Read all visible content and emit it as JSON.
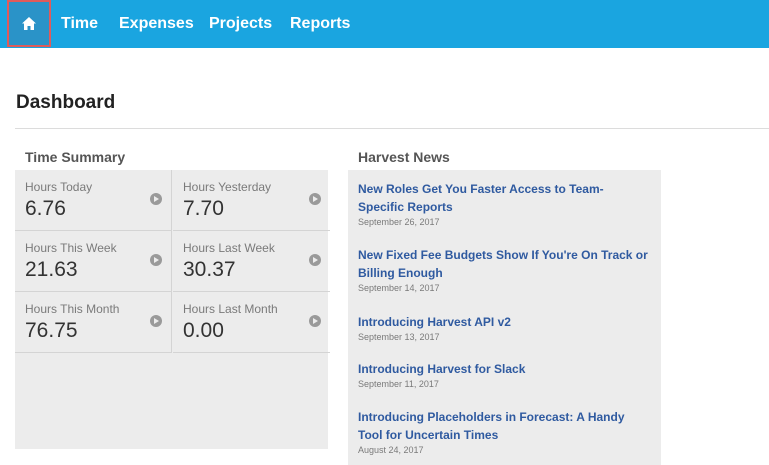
{
  "nav": {
    "home_icon": "home-icon",
    "items": [
      "Time",
      "Expenses",
      "Projects",
      "Reports"
    ]
  },
  "page": {
    "title": "Dashboard"
  },
  "time_summary": {
    "heading": "Time Summary",
    "cells": [
      {
        "label": "Hours Today",
        "value": "6.76"
      },
      {
        "label": "Hours Yesterday",
        "value": "7.70"
      },
      {
        "label": "Hours This Week",
        "value": "21.63"
      },
      {
        "label": "Hours Last Week",
        "value": "30.37"
      },
      {
        "label": "Hours This Month",
        "value": "76.75"
      },
      {
        "label": "Hours Last Month",
        "value": "0.00"
      }
    ]
  },
  "news": {
    "heading": "Harvest News",
    "items": [
      {
        "title": "New Roles Get You Faster Access to Team-Specific Reports",
        "date": "September 26, 2017"
      },
      {
        "title": "New Fixed Fee Budgets Show If You're On Track or Billing Enough",
        "date": "September 14, 2017"
      },
      {
        "title": "Introducing Harvest API v2",
        "date": "September 13, 2017"
      },
      {
        "title": "Introducing Harvest for Slack",
        "date": "September 11, 2017"
      },
      {
        "title": "Introducing Placeholders in Forecast: A Handy Tool for Uncertain Times",
        "date": "August 24, 2017"
      }
    ]
  },
  "colors": {
    "nav_bg": "#1aa5e0",
    "highlight_border": "#e05b5b",
    "link": "#2f5aa0",
    "panel_bg": "#ececec"
  }
}
